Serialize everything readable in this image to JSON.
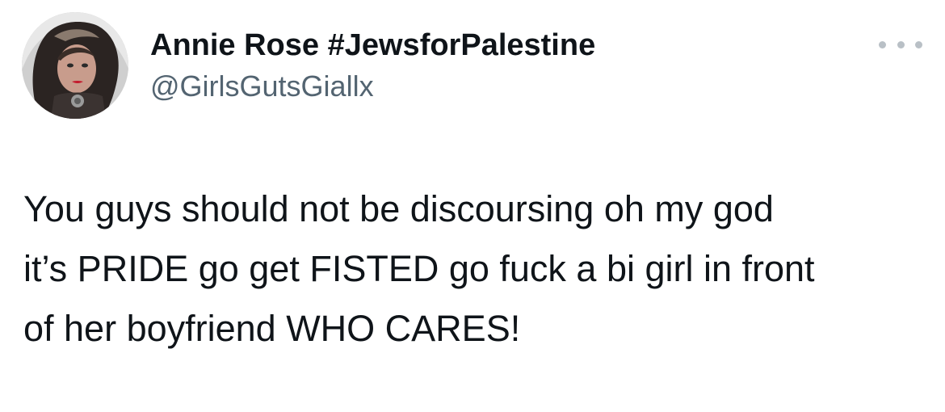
{
  "author": {
    "display_name": "Annie Rose #JewsforPalestine",
    "handle": "@GirlsGutsGiallx",
    "avatar_icon": "profile-photo"
  },
  "menu": {
    "icon": "more-options-icon"
  },
  "tweet": {
    "lines": [
      "You guys should not be discoursing oh my god",
      "it’s PRIDE go get FISTED go fuck a bi girl in front",
      "of her boyfriend WHO CARES!"
    ]
  },
  "colors": {
    "text": "#0f1419",
    "secondary_text": "#536471",
    "more_dots": "#b9c0c6"
  }
}
